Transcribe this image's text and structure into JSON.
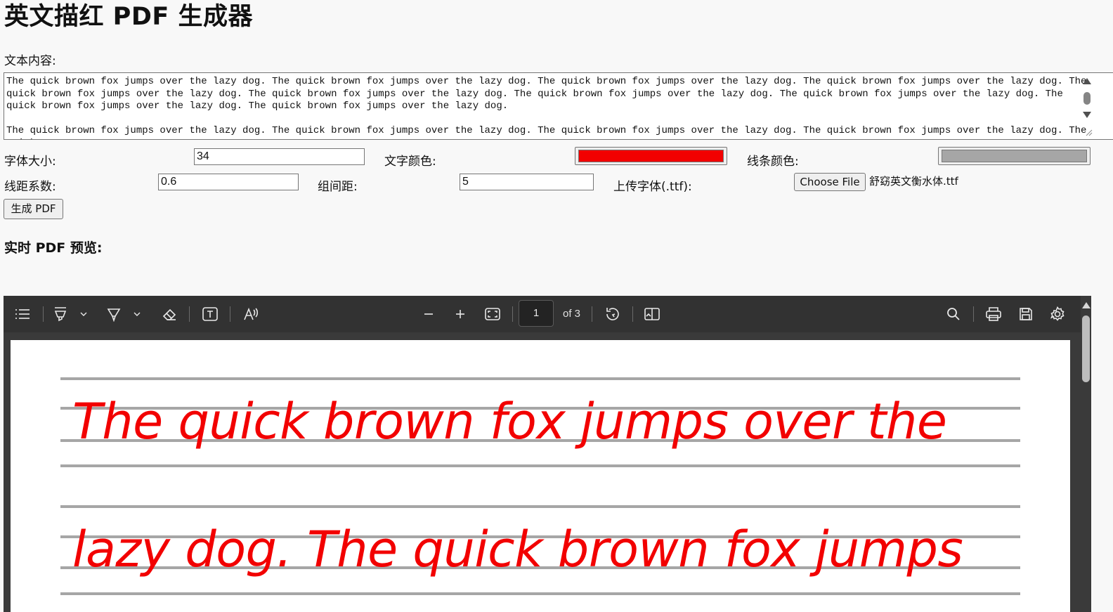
{
  "page_title": "英文描红 PDF 生成器",
  "form": {
    "content_label": "文本内容:",
    "content_value": "The quick brown fox jumps over the lazy dog. The quick brown fox jumps over the lazy dog. The quick brown fox jumps over the lazy dog. The quick brown fox jumps over the lazy dog. The quick brown fox jumps over the lazy dog. The quick brown fox jumps over the lazy dog. The quick brown fox jumps over the lazy dog. The quick brown fox jumps over the lazy dog. The quick brown fox jumps over the lazy dog. The quick brown fox jumps over the lazy dog.\n\nThe quick brown fox jumps over the lazy dog. The quick brown fox jumps over the lazy dog. The quick brown fox jumps over the lazy dog. The quick brown fox jumps over the lazy dog. The quick",
    "font_size_label": "字体大小:",
    "font_size_value": "34",
    "text_color_label": "文字颜色:",
    "text_color_value": "#f20000",
    "line_color_label": "线条颜色:",
    "line_color_value": "#a6a6a6",
    "line_spacing_label": "线距系数:",
    "line_spacing_value": "0.6",
    "group_spacing_label": "组间距:",
    "group_spacing_value": "5",
    "upload_font_label": "上传字体(.ttf):",
    "choose_file_label": "Choose File",
    "file_name": "舒窈英文衡水体.ttf",
    "generate_label": "生成 PDF"
  },
  "preview": {
    "heading": "实时 PDF 预览:",
    "toolbar": {
      "icons": [
        "menu-icon",
        "highlighter-icon",
        "pen-icon",
        "eraser-icon",
        "text-box-icon",
        "read-aloud-icon",
        "zoom-out-icon",
        "zoom-in-icon",
        "fit-page-icon",
        "rotate-icon",
        "two-page-icon",
        "search-icon",
        "print-icon",
        "save-icon",
        "settings-icon"
      ],
      "page_number": "1",
      "page_count": "of 3"
    },
    "page_lines": [
      "The quick brown fox jumps over the",
      "lazy dog. The quick brown fox jumps"
    ]
  }
}
